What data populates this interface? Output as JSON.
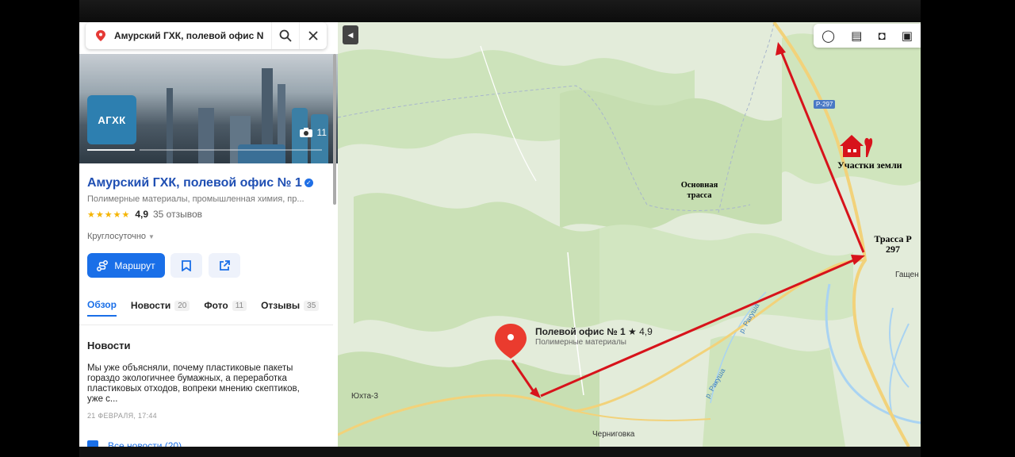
{
  "search": {
    "query": "Амурский ГХК, полевой офис N"
  },
  "place": {
    "logo_text": "АГХК",
    "photo_count": "11",
    "name": "Амурский ГХК, полевой офис № 1",
    "category": "Полимерные материалы, промышленная химия, пр...",
    "stars": "★★★★★",
    "rating": "4,9",
    "reviews": "35 отзывов",
    "hours": "Круглосуточно",
    "route_label": "Маршрут"
  },
  "tabs": [
    {
      "label": "Обзор",
      "count": ""
    },
    {
      "label": "Новости",
      "count": "20"
    },
    {
      "label": "Фото",
      "count": "11"
    },
    {
      "label": "Отзывы",
      "count": "35"
    }
  ],
  "news": {
    "heading": "Новости",
    "text": "Мы уже объясняли, почему пластиковые пакеты гораздо экологичнее бумажных, а переработка пластиковых отходов, вопреки мнению скептиков, уже с...",
    "date": "21 ФЕВРАЛЯ, 17:44",
    "all_news": "Все новости (20)"
  },
  "map": {
    "road_badge": "Р-297",
    "labels": {
      "main_route": "Основная трасса",
      "land_plots": "Участки земли",
      "highway": "Трасса Р 297",
      "village_yukhta": "Юхта-3",
      "village_chernigovka": "Черниговка",
      "village_gashchen": "Гащен",
      "river_1": "р. Ракуша",
      "river_2": "р. Ракуша"
    },
    "office_title": "Полевой офис № 1",
    "office_rating": "★ 4,9",
    "office_sub": "Полимерные материалы"
  },
  "colors": {
    "accent_blue": "#1a6fe8",
    "title_blue": "#1f4fb3",
    "arrow_red": "#d7131b",
    "road_yellow": "#f2d27a",
    "forest_green": "#c7dfb4",
    "water_blue": "#a9d3f2"
  }
}
